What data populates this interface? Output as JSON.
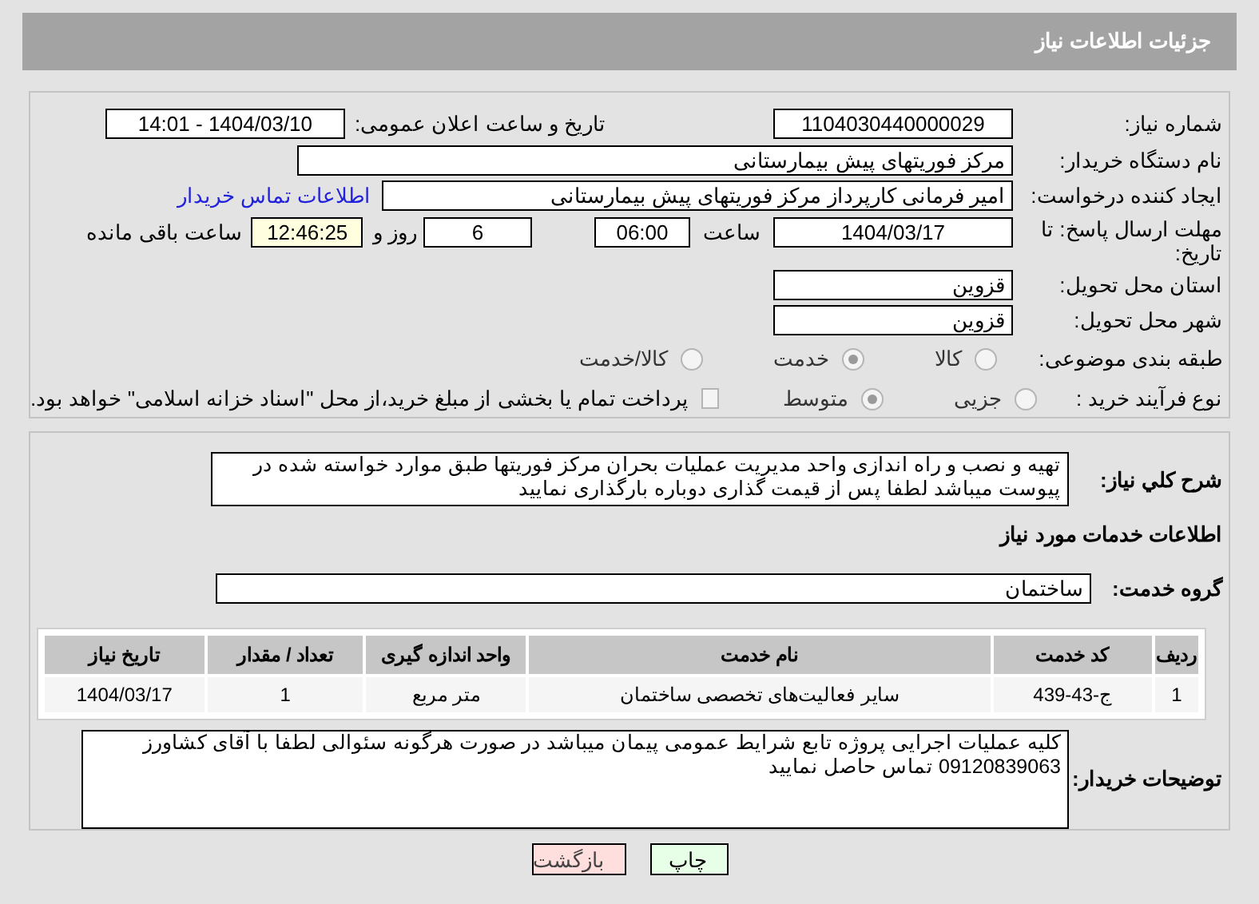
{
  "header": {
    "title": "جزئیات اطلاعات نیاز"
  },
  "details": {
    "need_number": {
      "label": "شماره نیاز:",
      "value": "1104030440000029"
    },
    "announce": {
      "label": "تاریخ و ساعت اعلان عمومی:",
      "value": "1404/03/10 - 14:01"
    },
    "buyer_org": {
      "label": "نام دستگاه خریدار:",
      "value": "مرکز فوریتهای پیش بیمارستانی"
    },
    "creator": {
      "label": "ایجاد کننده درخواست:",
      "value": "امیر فرمانی کارپرداز مرکز فوریتهای پیش بیمارستانی",
      "link": "اطلاعات تماس خریدار"
    },
    "deadline": {
      "label": "مهلت ارسال پاسخ: تا تاریخ:",
      "date": "1404/03/17",
      "time_label": "ساعت",
      "time": "06:00",
      "days": "6",
      "days_label": "روز و",
      "remaining": "12:46:25",
      "remaining_label": "ساعت باقی مانده"
    },
    "province": {
      "label": "استان محل تحویل:",
      "value": "قزوین"
    },
    "city": {
      "label": "شهر محل تحویل:",
      "value": "قزوین"
    },
    "category": {
      "label": "طبقه بندی موضوعی:",
      "options": [
        {
          "label": "کالا",
          "selected": false
        },
        {
          "label": "خدمت",
          "selected": true
        },
        {
          "label": "کالا/خدمت",
          "selected": false
        }
      ]
    },
    "purchase_type": {
      "label": "نوع فرآیند خرید :",
      "options": [
        {
          "label": "جزیی",
          "selected": false
        },
        {
          "label": "متوسط",
          "selected": true
        }
      ],
      "payment": {
        "checked": false,
        "label": "پرداخت تمام یا بخشی از مبلغ خرید،از محل \"اسناد خزانه اسلامی\" خواهد بود."
      }
    }
  },
  "need": {
    "summary_label": "شرح کلي نياز:",
    "summary": "تهیه و نصب و راه اندازی واحد مدیریت عملیات بحران مرکز فوریتها طبق موارد خواسته شده در پیوست میباشد لطفا پس از قیمت گذاری دوباره بارگذاری نمایید",
    "services_title": "اطلاعات خدمات مورد نیاز",
    "group_label": "گروه خدمت:",
    "group": "ساختمان",
    "table": {
      "columns": [
        "ردیف",
        "کد خدمت",
        "نام خدمت",
        "واحد اندازه گیری",
        "تعداد / مقدار",
        "تاریخ نیاز"
      ],
      "rows": [
        [
          "1",
          "ج-43-439",
          "سایر فعالیت‌های تخصصی ساختمان",
          "متر مربع",
          "1",
          "1404/03/17"
        ]
      ]
    },
    "notes_label": "توضیحات خریدار:",
    "notes": "کلیه عملیات اجرایی پروژه تابع شرایط عمومی پیمان میباشد در صورت هرگونه سئوالی لطفا با آقای کشاورز 09120839063 تماس حاصل نمایید"
  },
  "buttons": [
    {
      "label": "چاپ",
      "kind": "print"
    },
    {
      "label": "بازگشت",
      "kind": "back"
    }
  ]
}
